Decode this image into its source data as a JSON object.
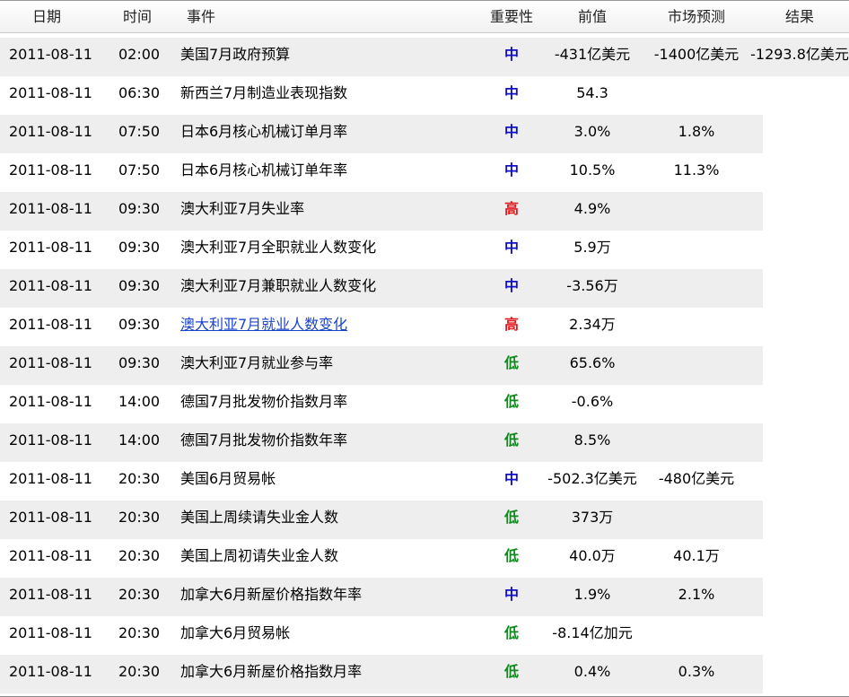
{
  "headers": {
    "date": "日期",
    "time": "时间",
    "event": "事件",
    "importance": "重要性",
    "previous": "前值",
    "forecast": "市场预测",
    "result": "结果"
  },
  "rows": [
    {
      "date": "2011-08-11",
      "time": "02:00",
      "event": "美国7月政府预算",
      "importance": "中",
      "level": "mid",
      "previous": "-431亿美元",
      "forecast": "-1400亿美元",
      "result": "-1293.8亿美元",
      "link": false
    },
    {
      "date": "2011-08-11",
      "time": "06:30",
      "event": "新西兰7月制造业表现指数",
      "importance": "中",
      "level": "mid",
      "previous": "54.3",
      "forecast": "",
      "result": "",
      "link": false
    },
    {
      "date": "2011-08-11",
      "time": "07:50",
      "event": "日本6月核心机械订单月率",
      "importance": "中",
      "level": "mid",
      "previous": "3.0%",
      "forecast": "1.8%",
      "result": "",
      "link": false
    },
    {
      "date": "2011-08-11",
      "time": "07:50",
      "event": "日本6月核心机械订单年率",
      "importance": "中",
      "level": "mid",
      "previous": "10.5%",
      "forecast": "11.3%",
      "result": "",
      "link": false
    },
    {
      "date": "2011-08-11",
      "time": "09:30",
      "event": "澳大利亚7月失业率",
      "importance": "高",
      "level": "high",
      "previous": "4.9%",
      "forecast": "",
      "result": "",
      "link": false
    },
    {
      "date": "2011-08-11",
      "time": "09:30",
      "event": "澳大利亚7月全职就业人数变化",
      "importance": "中",
      "level": "mid",
      "previous": "5.9万",
      "forecast": "",
      "result": "",
      "link": false
    },
    {
      "date": "2011-08-11",
      "time": "09:30",
      "event": "澳大利亚7月兼职就业人数变化",
      "importance": "中",
      "level": "mid",
      "previous": "-3.56万",
      "forecast": "",
      "result": "",
      "link": false
    },
    {
      "date": "2011-08-11",
      "time": "09:30",
      "event": "澳大利亚7月就业人数变化",
      "importance": "高",
      "level": "high",
      "previous": "2.34万",
      "forecast": "",
      "result": "",
      "link": true
    },
    {
      "date": "2011-08-11",
      "time": "09:30",
      "event": "澳大利亚7月就业参与率",
      "importance": "低",
      "level": "low",
      "previous": "65.6%",
      "forecast": "",
      "result": "",
      "link": false
    },
    {
      "date": "2011-08-11",
      "time": "14:00",
      "event": "德国7月批发物价指数月率",
      "importance": "低",
      "level": "low",
      "previous": "-0.6%",
      "forecast": "",
      "result": "",
      "link": false
    },
    {
      "date": "2011-08-11",
      "time": "14:00",
      "event": "德国7月批发物价指数年率",
      "importance": "低",
      "level": "low",
      "previous": "8.5%",
      "forecast": "",
      "result": "",
      "link": false
    },
    {
      "date": "2011-08-11",
      "time": "20:30",
      "event": "美国6月贸易帐",
      "importance": "中",
      "level": "mid",
      "previous": "-502.3亿美元",
      "forecast": "-480亿美元",
      "result": "",
      "link": false
    },
    {
      "date": "2011-08-11",
      "time": "20:30",
      "event": "美国上周续请失业金人数",
      "importance": "低",
      "level": "low",
      "previous": "373万",
      "forecast": "",
      "result": "",
      "link": false
    },
    {
      "date": "2011-08-11",
      "time": "20:30",
      "event": "美国上周初请失业金人数",
      "importance": "低",
      "level": "low",
      "previous": "40.0万",
      "forecast": "40.1万",
      "result": "",
      "link": false
    },
    {
      "date": "2011-08-11",
      "time": "20:30",
      "event": "加拿大6月新屋价格指数年率",
      "importance": "中",
      "level": "mid",
      "previous": "1.9%",
      "forecast": "2.1%",
      "result": "",
      "link": false
    },
    {
      "date": "2011-08-11",
      "time": "20:30",
      "event": "加拿大6月贸易帐",
      "importance": "低",
      "level": "low",
      "previous": "-8.14亿加元",
      "forecast": "",
      "result": "",
      "link": false
    },
    {
      "date": "2011-08-11",
      "time": "20:30",
      "event": "加拿大6月新屋价格指数月率",
      "importance": "低",
      "level": "low",
      "previous": "0.4%",
      "forecast": "0.3%",
      "result": "",
      "link": false
    }
  ]
}
